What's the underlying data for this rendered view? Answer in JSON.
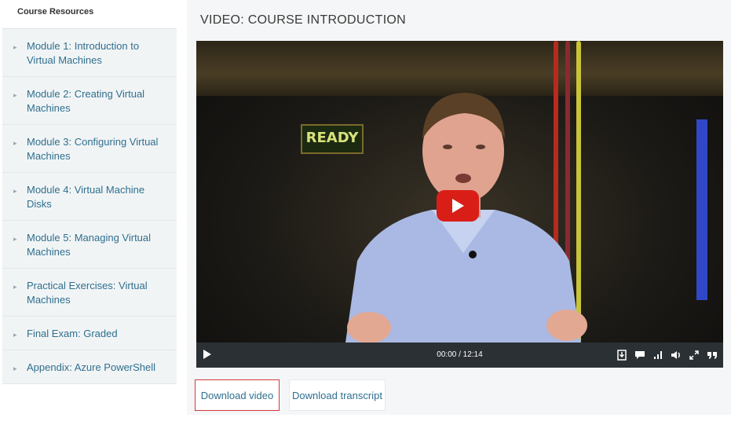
{
  "sidebar": {
    "title": "Course Resources",
    "items": [
      {
        "label": "Module 1: Introduction to Virtual Machines"
      },
      {
        "label": "Module 2: Creating Virtual Machines"
      },
      {
        "label": "Module 3: Configuring Virtual Machines"
      },
      {
        "label": "Module 4: Virtual Machine Disks"
      },
      {
        "label": "Module 5: Managing Virtual Machines"
      },
      {
        "label": "Practical Exercises: Virtual Machines"
      },
      {
        "label": "Final Exam: Graded"
      },
      {
        "label": "Appendix: Azure PowerShell"
      }
    ]
  },
  "main": {
    "title": "VIDEO: COURSE INTRODUCTION",
    "video": {
      "sign_text": "READY",
      "time": "00:00 / 12:14",
      "icons": [
        "download-icon",
        "captions-icon",
        "quality-icon",
        "volume-icon",
        "fullscreen-icon",
        "quote-icon"
      ]
    },
    "buttons": {
      "download_video": "Download video",
      "download_transcript": "Download transcript"
    }
  },
  "colors": {
    "link": "#2f6f8f",
    "play_button": "#d91e18",
    "active_border": "#d23a3a"
  }
}
